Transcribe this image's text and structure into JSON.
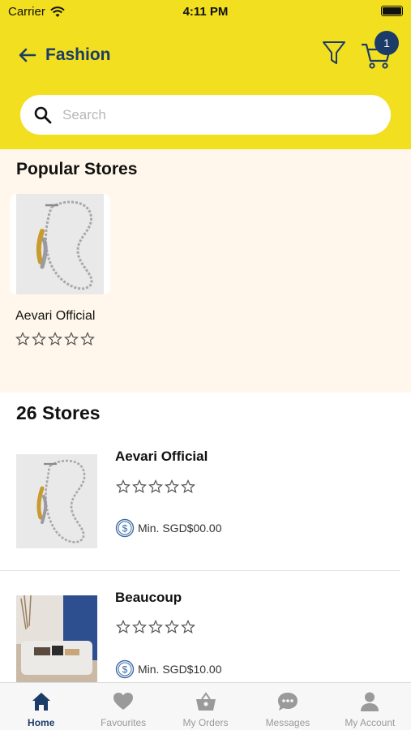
{
  "status_bar": {
    "carrier": "Carrier",
    "time": "4:11 PM"
  },
  "header": {
    "title": "Fashion",
    "cart_count": "1",
    "icons": [
      "back-arrow-icon",
      "filter-icon",
      "cart-icon"
    ]
  },
  "search": {
    "placeholder": "Search",
    "value": ""
  },
  "popular": {
    "title": "Popular Stores",
    "stores": [
      {
        "name": "Aevari Official",
        "rating": 0
      }
    ]
  },
  "stores": {
    "title": "26 Stores",
    "items": [
      {
        "name": "Aevari Official",
        "rating": 0,
        "min_order": "Min. SGD$00.00"
      },
      {
        "name": "Beaucoup",
        "rating": 0,
        "min_order": "Min. SGD$10.00"
      }
    ]
  },
  "tabs": [
    {
      "label": "Home",
      "icon": "home-icon",
      "active": true
    },
    {
      "label": "Favourites",
      "icon": "heart-icon",
      "active": false
    },
    {
      "label": "My Orders",
      "icon": "basket-icon",
      "active": false
    },
    {
      "label": "Messages",
      "icon": "chat-bubble-icon",
      "active": false
    },
    {
      "label": "My Account",
      "icon": "person-icon",
      "active": false
    }
  ],
  "colors": {
    "header_bg": "#f2df1f",
    "brand_navy": "#1b3c68",
    "popular_bg": "#fff7eb"
  }
}
